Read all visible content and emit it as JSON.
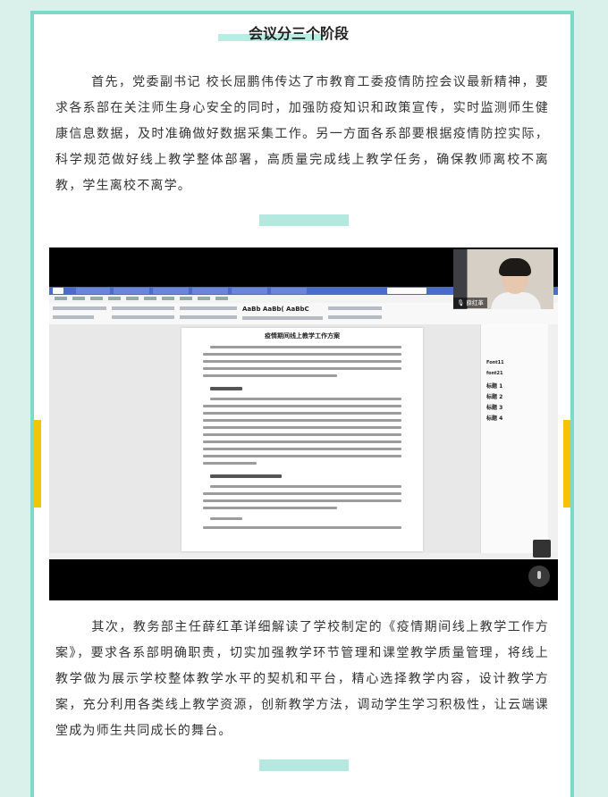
{
  "section_title": "会议分三个阶段",
  "paragraph_1": "首先，党委副书记 校长屈鹏伟传达了市教育工委疫情防控会议最新精神，要求各系部在关注师生身心安全的同时，加强防疫知识和政策宣传，实时监测师生健康信息数据，及时准确做好数据采集工作。另一方面各系部要根据疫情防控实际，科学规范做好线上教学整体部署，高质量完成线上教学任务，确保教师离校不离教，学生离校不离学。",
  "paragraph_2": "其次，教务部主任薛红革详细解读了学校制定的《疫情期间线上教学工作方案》，要求各系部明确职责，切实加强教学环节管理和课堂教学质量管理，将线上教学做为展示学校整体教学水平的契机和平台，精心选择教学内容，设计教学方案，充分利用各类线上教学资源，创新教学方法，调动学生学习积极性，让云端课堂成为师生共同成长的舞台。",
  "screenshot": {
    "doc_title": "疫情期间线上教学工作方案",
    "ribbon_styles": "AaBb AaBb( AaBbC",
    "video_name": "薛红革",
    "style_panel_items": [
      "Font11",
      "font21",
      "标题 1",
      "标题 2",
      "标题 3",
      "标题 4"
    ]
  },
  "colors": {
    "background": "#d9f1ea",
    "frame_border": "#7fd9c8",
    "divider": "#b5e8df",
    "side_accent": "#f5c400"
  }
}
